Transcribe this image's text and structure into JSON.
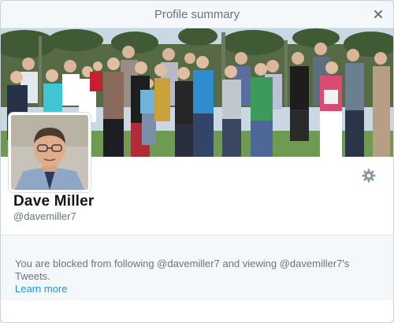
{
  "dialog": {
    "title": "Profile summary",
    "close_icon": "close-icon"
  },
  "profile": {
    "name": "Dave Miller",
    "handle": "@davemiller7",
    "settings_icon": "gear-icon"
  },
  "blocked_notice": {
    "message": "You are blocked from following @davemiller7 and viewing @davemiller7's Tweets.",
    "learn_more": "Learn more"
  },
  "colors": {
    "link": "#1b95e0",
    "muted_text": "#66757f",
    "header_bg": "#f5f8fa"
  }
}
